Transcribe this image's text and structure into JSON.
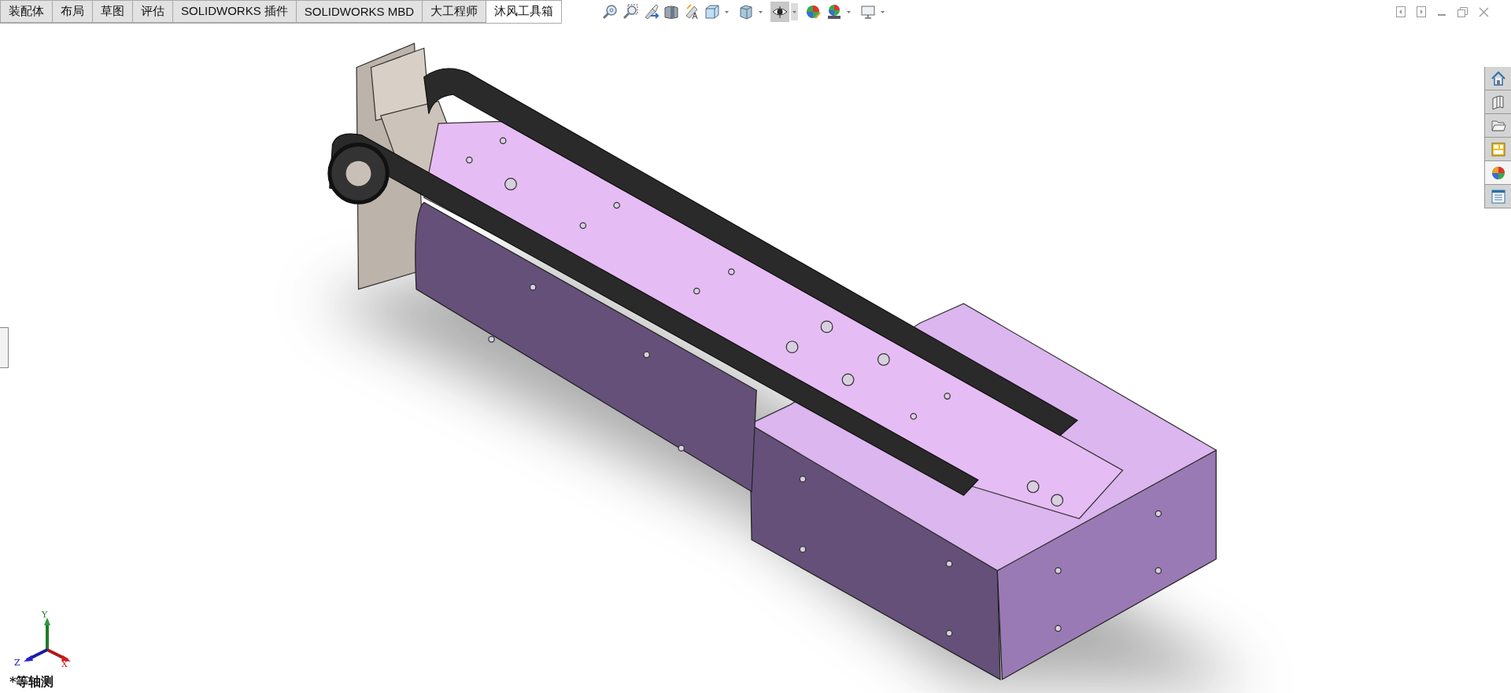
{
  "tabs": [
    {
      "label": "装配体",
      "selected": false
    },
    {
      "label": "布局",
      "selected": false
    },
    {
      "label": "草图",
      "selected": false
    },
    {
      "label": "评估",
      "selected": false
    },
    {
      "label": "SOLIDWORKS 插件",
      "selected": false
    },
    {
      "label": "SOLIDWORKS MBD",
      "selected": false
    },
    {
      "label": "大工程师",
      "selected": false
    },
    {
      "label": "沐风工具箱",
      "selected": true
    }
  ],
  "view_toolbar": [
    {
      "kind": "zoom-fit",
      "pressed": false,
      "dropdown": false
    },
    {
      "kind": "zoom-area",
      "pressed": false,
      "dropdown": false
    },
    {
      "kind": "previous-view",
      "pressed": false,
      "dropdown": false
    },
    {
      "kind": "section-view",
      "pressed": false,
      "dropdown": false
    },
    {
      "kind": "dynamic-annotation",
      "pressed": false,
      "dropdown": false
    },
    {
      "kind": "view-orientation",
      "pressed": false,
      "dropdown": true
    },
    {
      "kind": "display-style",
      "pressed": false,
      "dropdown": true
    },
    {
      "kind": "hide-show",
      "pressed": true,
      "dropdown": true
    },
    {
      "kind": "edit-appearance",
      "pressed": false,
      "dropdown": false
    },
    {
      "kind": "apply-scene",
      "pressed": false,
      "dropdown": true
    },
    {
      "kind": "view-settings",
      "pressed": false,
      "dropdown": true
    }
  ],
  "task_pane": [
    {
      "kind": "home",
      "selected": false
    },
    {
      "kind": "library",
      "selected": false
    },
    {
      "kind": "explorer",
      "selected": false
    },
    {
      "kind": "palette",
      "selected": false
    },
    {
      "kind": "appearances",
      "selected": true
    },
    {
      "kind": "properties",
      "selected": false
    }
  ],
  "triad": {
    "x": "X",
    "y": "Y",
    "z": "Z"
  },
  "view_label": "*等轴测"
}
